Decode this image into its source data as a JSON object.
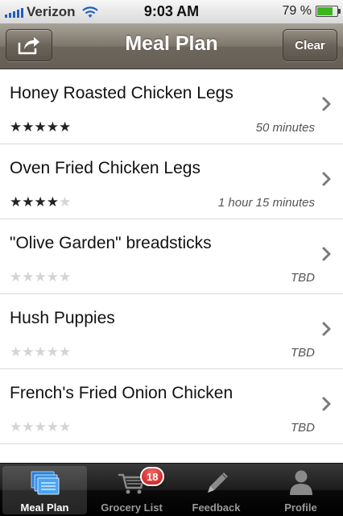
{
  "status_bar": {
    "carrier": "Verizon",
    "time": "9:03 AM",
    "battery_percent": "79 %",
    "battery_level": 0.79
  },
  "nav": {
    "title": "Meal Plan",
    "clear_label": "Clear",
    "share_icon": "share-icon"
  },
  "meals": [
    {
      "title": "Honey Roasted Chicken Legs",
      "rating": 5,
      "time": "50 minutes"
    },
    {
      "title": "Oven Fried Chicken Legs",
      "rating": 4,
      "time": "1 hour 15 minutes"
    },
    {
      "title": "\"Olive Garden\" breadsticks",
      "rating": 0,
      "time": "TBD"
    },
    {
      "title": "Hush Puppies",
      "rating": 0,
      "time": "TBD"
    },
    {
      "title": "French's Fried Onion Chicken",
      "rating": 0,
      "time": "TBD"
    }
  ],
  "tabs": [
    {
      "label": "Meal Plan",
      "icon": "meal-plan-icon",
      "selected": true
    },
    {
      "label": "Grocery List",
      "icon": "shopping-cart-icon",
      "badge": "18"
    },
    {
      "label": "Feedback",
      "icon": "pencil-icon"
    },
    {
      "label": "Profile",
      "icon": "person-icon"
    }
  ],
  "colors": {
    "nav_bar": "#7d766b",
    "badge": "#d71f1f",
    "star_on": "#222222",
    "star_off": "#d4d4d4"
  }
}
